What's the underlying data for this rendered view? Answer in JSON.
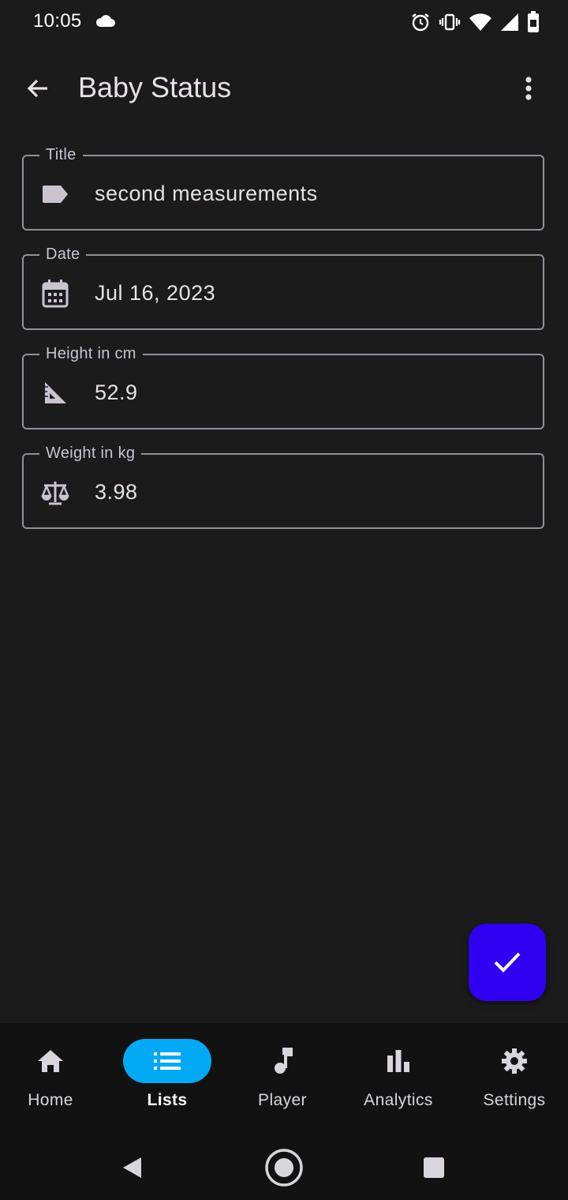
{
  "status_bar": {
    "time": "10:05",
    "icons": [
      "cloud-icon",
      "alarm-icon",
      "vibrate-icon",
      "wifi-icon",
      "signal-icon",
      "battery-icon"
    ]
  },
  "app_bar": {
    "title": "Baby Status",
    "back_icon": "arrow-back-icon",
    "menu_icon": "more-vert-icon"
  },
  "form": {
    "fields": [
      {
        "label": "Title",
        "value": "second measurements",
        "icon": "label-icon"
      },
      {
        "label": "Date",
        "value": "Jul 16, 2023",
        "icon": "calendar-icon"
      },
      {
        "label": "Height in cm",
        "value": "52.9",
        "icon": "ruler-square-icon"
      },
      {
        "label": "Weight in kg",
        "value": "3.98",
        "icon": "scale-icon"
      }
    ]
  },
  "fab": {
    "icon": "check-icon",
    "color": "#2f00f0"
  },
  "bottom_nav": {
    "items": [
      {
        "label": "Home",
        "icon": "home-icon",
        "active": false
      },
      {
        "label": "Lists",
        "icon": "list-icon",
        "active": true
      },
      {
        "label": "Player",
        "icon": "music-note-icon",
        "active": false
      },
      {
        "label": "Analytics",
        "icon": "bar-chart-icon",
        "active": false
      },
      {
        "label": "Settings",
        "icon": "gear-icon",
        "active": false
      }
    ],
    "active_color": "#03a9f4"
  },
  "system_nav": [
    "back-triangle-icon",
    "home-circle-icon",
    "recents-square-icon"
  ]
}
